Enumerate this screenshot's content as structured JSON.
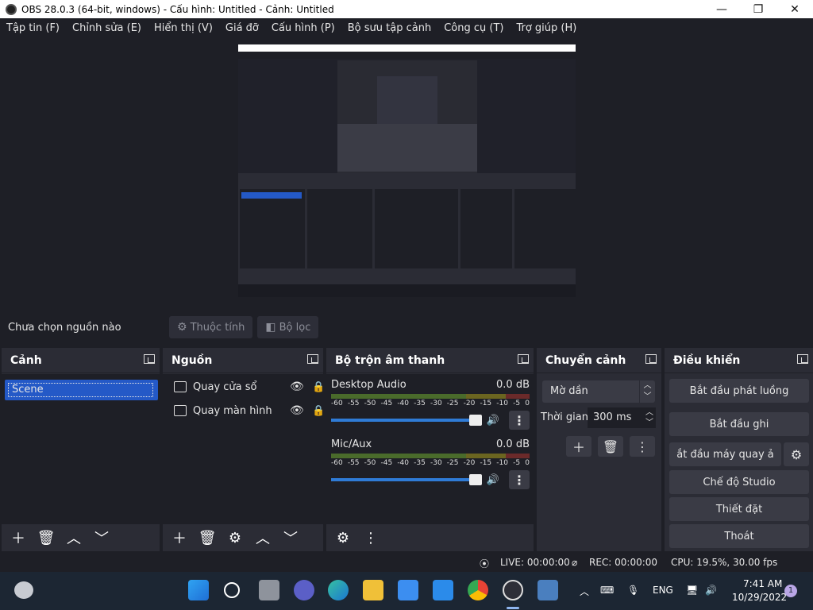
{
  "window": {
    "title": "OBS 28.0.3 (64-bit, windows) - Cấu hình: Untitled - Cảnh: Untitled",
    "minimize": "—",
    "maximize": "❐",
    "close": "✕"
  },
  "menu": [
    "Tập tin (F)",
    "Chỉnh sửa (E)",
    "Hiển thị (V)",
    "Giá đỡ",
    "Cấu hình (P)",
    "Bộ sưu tập cảnh",
    "Công cụ (T)",
    "Trợ giúp (H)"
  ],
  "source_toolbar": {
    "no_source": "Chưa chọn nguồn nào",
    "properties": "Thuộc tính",
    "filters": "Bộ lọc"
  },
  "scenes": {
    "title": "Cảnh",
    "items": [
      "Scene"
    ]
  },
  "sources": {
    "title": "Nguồn",
    "items": [
      "Quay cửa sổ",
      "Quay màn hình"
    ]
  },
  "mixer": {
    "title": "Bộ trộn âm thanh",
    "ticks": [
      "-60",
      "-55",
      "-50",
      "-45",
      "-40",
      "-35",
      "-30",
      "-25",
      "-20",
      "-15",
      "-10",
      "-5",
      "0"
    ],
    "channels": [
      {
        "name": "Desktop Audio",
        "db": "0.0 dB",
        "level": 1.0
      },
      {
        "name": "Mic/Aux",
        "db": "0.0 dB",
        "level": 1.0
      }
    ]
  },
  "transitions": {
    "title": "Chuyển cảnh",
    "selected": "Mờ dần",
    "duration_label": "Thời gian",
    "duration": "300 ms"
  },
  "controls": {
    "title": "Điều khiển",
    "buttons": [
      "Bắt đầu phát luồng",
      "Bắt đầu ghi",
      "ắt đầu máy quay ả",
      "Chế độ Studio",
      "Thiết đặt",
      "Thoát"
    ]
  },
  "status": {
    "live": "LIVE: 00:00:00",
    "rec": "REC: 00:00:00",
    "cpu": "CPU: 19.5%, 30.00 fps"
  },
  "taskbar": {
    "lang": "ENG",
    "time": "7:41 AM",
    "date": "10/29/2022",
    "notif": "1"
  }
}
